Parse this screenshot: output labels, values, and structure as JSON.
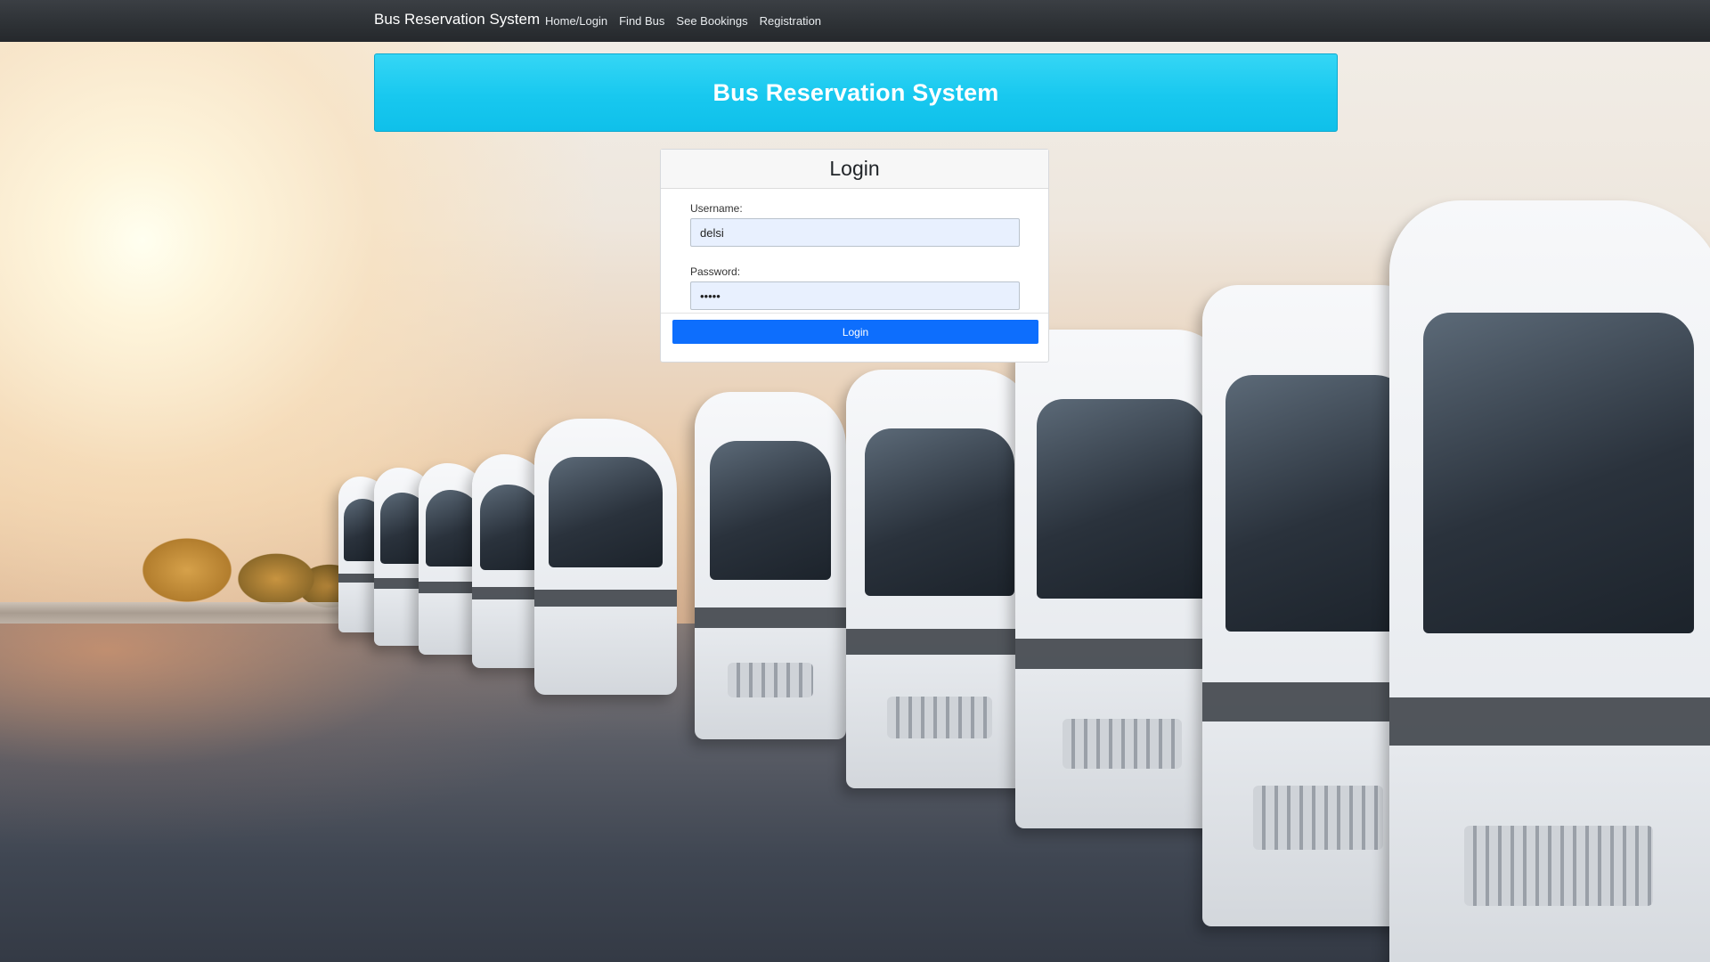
{
  "navbar": {
    "brand": "Bus Reservation System",
    "links": [
      "Home/Login",
      "Find Bus",
      "See Bookings",
      "Registration"
    ]
  },
  "banner": {
    "title": "Bus Reservation System"
  },
  "login": {
    "title": "Login",
    "username_label": "Username:",
    "username_value": "delsi",
    "password_label": "Password:",
    "password_value": "•••••",
    "submit_label": "Login"
  },
  "colors": {
    "navbar": "#2d3135",
    "banner": "#18c8ef",
    "primary_button": "#0d6efd",
    "input_fill": "#e8f0fe"
  }
}
